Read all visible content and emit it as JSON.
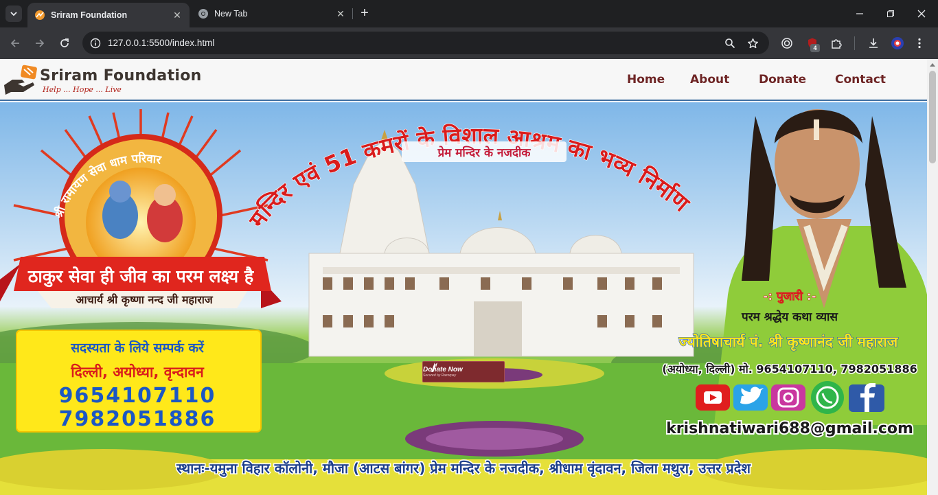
{
  "browser": {
    "tabs": [
      {
        "title": "Sriram Foundation",
        "active": true
      },
      {
        "title": "New Tab",
        "active": false
      }
    ],
    "url": "127.0.0.1:5500/index.html",
    "extension_badge": "4"
  },
  "site": {
    "logo_name": "Sriram Foundation",
    "logo_tagline": "Help ... Hope ... Live",
    "nav": [
      "Home",
      "About",
      "Donate",
      "Contact"
    ]
  },
  "banner": {
    "arc_heading": "मन्दिर एवं 51 कमरों के विशाल आश्रम का भव्य निर्माण",
    "sub_heading": "प्रेम मन्दिर के नजदीक",
    "seal_text": "श्री रामायण सेवा धाम परिवार",
    "ribbon_text": "ठाकुर सेवा ही जीव का परम लक्ष्य है",
    "acharya_text": "आचार्य श्री कृष्णा नन्द जी महाराज",
    "membership": {
      "heading": "सदस्यता के लिये सम्पर्क  करें",
      "cities": "दिल्ली, अयोध्या, वृन्दावन",
      "phone1": "9654107110",
      "phone2": "7982051886"
    },
    "pujari": {
      "label": "-: पुजारी :-",
      "line1": "परम श्रद्धेय कथा व्यास",
      "name": "ज्योतिषाचार्य पं. श्री कृष्णानंद जी महाराज",
      "contact": "(अयोध्या, दिल्ली) मो. 9654107110, 7982051886"
    },
    "email": "krishnatiwari688@gmail.com",
    "address": "स्थानः-यमुना विहार कॉलोनी, मौजा (आटस बांगर) प्रेम मन्दिर के नजदीक, श्रीधाम वृंदावन, जिला मथुरा, उत्तर प्रदेश"
  },
  "donate_button": {
    "label": "Donate Now",
    "sublabel": "Secured by Razorpay"
  },
  "colors": {
    "nav_text": "#6e2525",
    "donate_bg": "#7e2a2e",
    "arc_text": "#d91c1c",
    "phone_blue": "#1b57c4"
  }
}
